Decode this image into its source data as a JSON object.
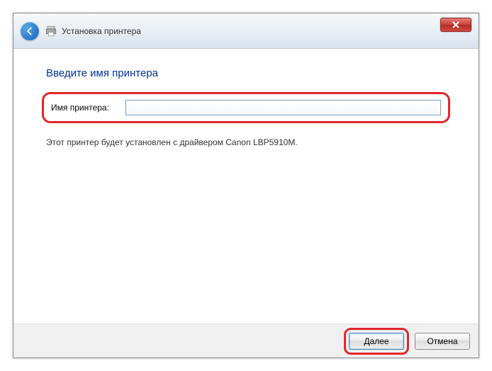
{
  "titlebar": {
    "title": "Установка принтера"
  },
  "content": {
    "heading": "Введите имя принтера",
    "input_label": "Имя принтера:",
    "input_value": "",
    "info_text": "Этот принтер будет установлен с драйвером Canon LBP5910M."
  },
  "footer": {
    "next_label": "Далее",
    "cancel_label": "Отмена"
  }
}
